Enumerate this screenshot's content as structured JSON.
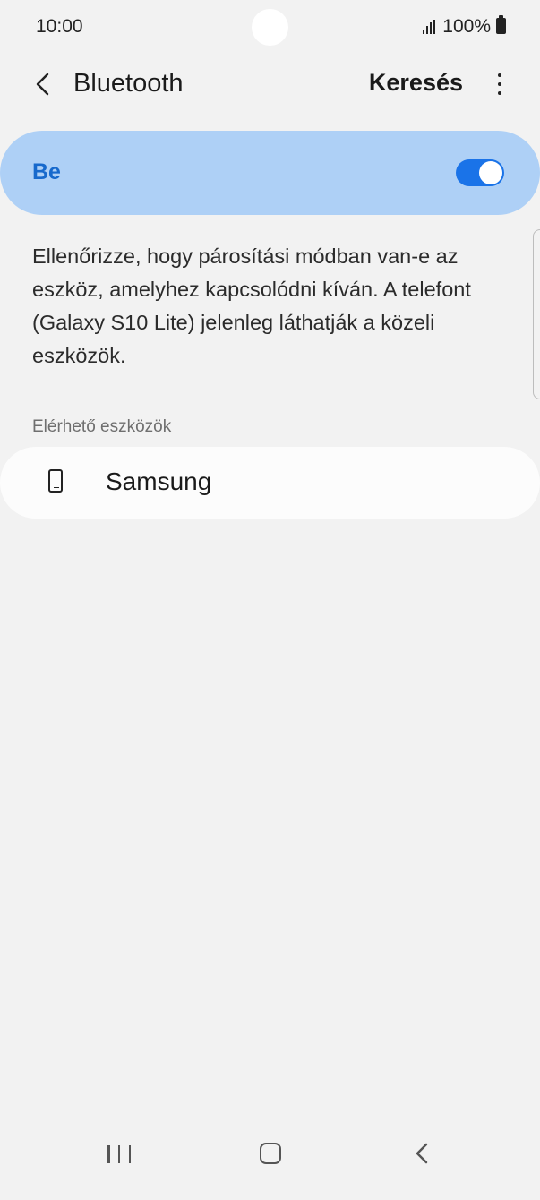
{
  "status_bar": {
    "time": "10:00",
    "battery_text": "100%",
    "signal_icon": "signal-bars-icon",
    "battery_icon": "battery-full-icon"
  },
  "app_bar": {
    "back_icon": "chevron-left-icon",
    "title": "Bluetooth",
    "search_label": "Keresés",
    "more_icon": "more-vertical-icon"
  },
  "toggle": {
    "label": "Be",
    "state": "on",
    "accent_color": "#1a73e8",
    "card_color": "#aed0f6"
  },
  "description": "Ellenőrizze, hogy párosítási módban van-e az eszköz, amelyhez kapcsolódni kíván. A telefont (Galaxy S10 Lite) jelenleg láthatják a közeli eszközök.",
  "available_devices": {
    "header": "Elérhető eszközök",
    "items": [
      {
        "name": "Samsung",
        "icon": "smartphone-icon"
      }
    ]
  },
  "nav_bar": {
    "recent_icon": "recent-apps-icon",
    "home_icon": "home-icon",
    "back_icon": "back-icon"
  }
}
